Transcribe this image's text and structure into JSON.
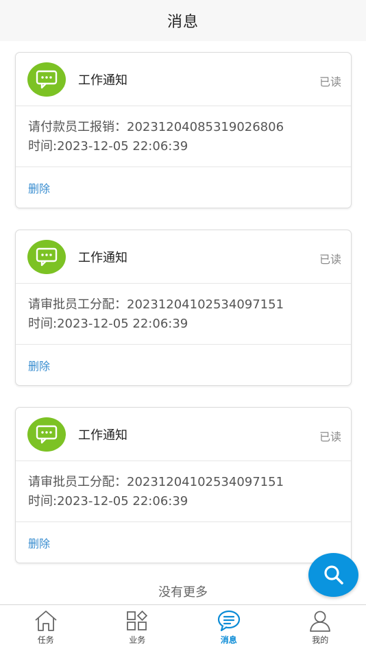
{
  "header": {
    "title": "消息"
  },
  "messages": [
    {
      "title": "工作通知",
      "status": "已读",
      "content": "请付款员工报销：20231204085319026806",
      "time": "时间:2023-12-05 22:06:39",
      "delete_label": "删除"
    },
    {
      "title": "工作通知",
      "status": "已读",
      "content": "请审批员工分配：20231204102534097151",
      "time": "时间:2023-12-05 22:06:39",
      "delete_label": "删除"
    },
    {
      "title": "工作通知",
      "status": "已读",
      "content": "请审批员工分配：20231204102534097151",
      "time": "时间:2023-12-05 22:06:39",
      "delete_label": "删除"
    }
  ],
  "list_footer": {
    "no_more": "没有更多"
  },
  "tabbar": {
    "items": [
      {
        "label": "任务",
        "icon": "home-icon",
        "active": false
      },
      {
        "label": "业务",
        "icon": "grid-icon",
        "active": false
      },
      {
        "label": "消息",
        "icon": "chat-icon",
        "active": true
      },
      {
        "label": "我的",
        "icon": "user-icon",
        "active": false
      }
    ]
  },
  "colors": {
    "accent": "#0a8bd6",
    "avatar_green": "#7cc224",
    "fab_blue": "#0a94df",
    "link_blue": "#3a8ed0"
  }
}
